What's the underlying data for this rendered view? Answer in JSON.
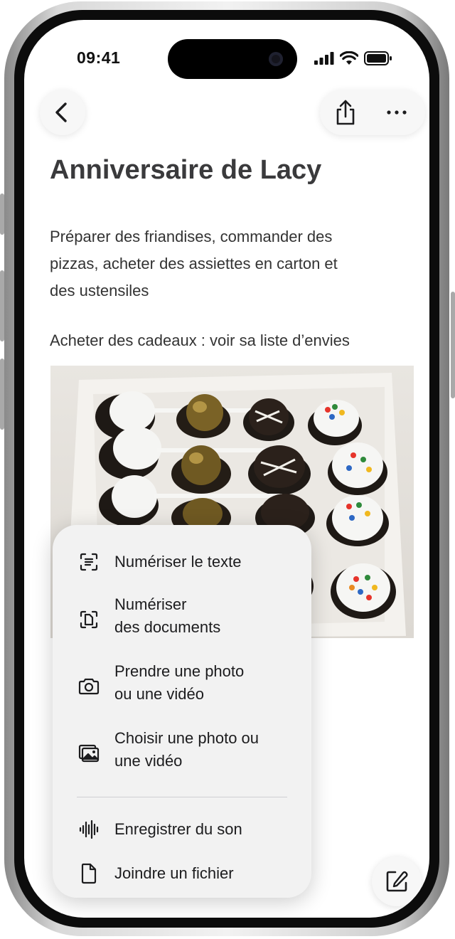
{
  "status_bar": {
    "time": "09:41"
  },
  "note": {
    "title": "Anniversaire de Lacy",
    "paragraph_lines": [
      "Préparer des friandises, commander des",
      "pizzas, acheter des assiettes en carton et",
      "des ustensiles"
    ],
    "paragraph2": "Acheter des cadeaux : voir sa liste d’envies"
  },
  "toolbar": {
    "back_icon": "chevron-left-icon",
    "share_icon": "share-icon",
    "more_icon": "ellipsis-icon",
    "compose_icon": "compose-icon"
  },
  "menu": {
    "items": [
      {
        "lines": [
          "Numériser le texte"
        ],
        "icon": "scan-text-icon"
      },
      {
        "lines": [
          "Numériser",
          "des documents"
        ],
        "icon": "scan-document-icon"
      },
      {
        "lines": [
          "Prendre une photo",
          "ou une vidéo"
        ],
        "icon": "camera-icon"
      },
      {
        "lines": [
          "Choisir une photo ou",
          "une vidéo"
        ],
        "icon": "photo-library-icon"
      },
      {
        "lines": [
          "Enregistrer du son"
        ],
        "icon": "waveform-icon"
      },
      {
        "lines": [
          "Joindre un fichier"
        ],
        "icon": "document-icon"
      }
    ]
  },
  "colors": {
    "title": "#3a3a3c",
    "menu_bg": "#f2f2f2",
    "text": "#1c1c1e"
  }
}
